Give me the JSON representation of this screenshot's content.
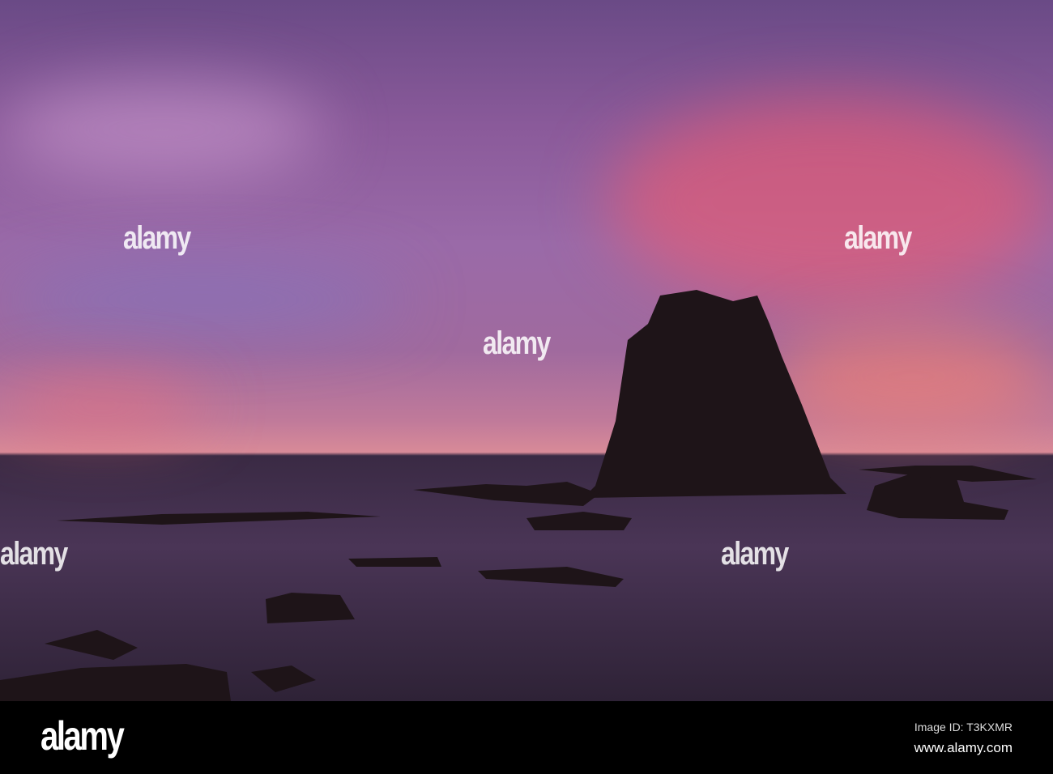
{
  "watermark": {
    "text": "alamy"
  },
  "footer": {
    "logo": "alamy",
    "image_id": "Image ID: T3KXMR",
    "url": "www.alamy.com"
  },
  "colors": {
    "sky_top": "#6a4a86",
    "sky_pink": "#e0607a",
    "horizon": "#d88a98",
    "sea": "#3a2a44",
    "rock": "#1e1418"
  }
}
